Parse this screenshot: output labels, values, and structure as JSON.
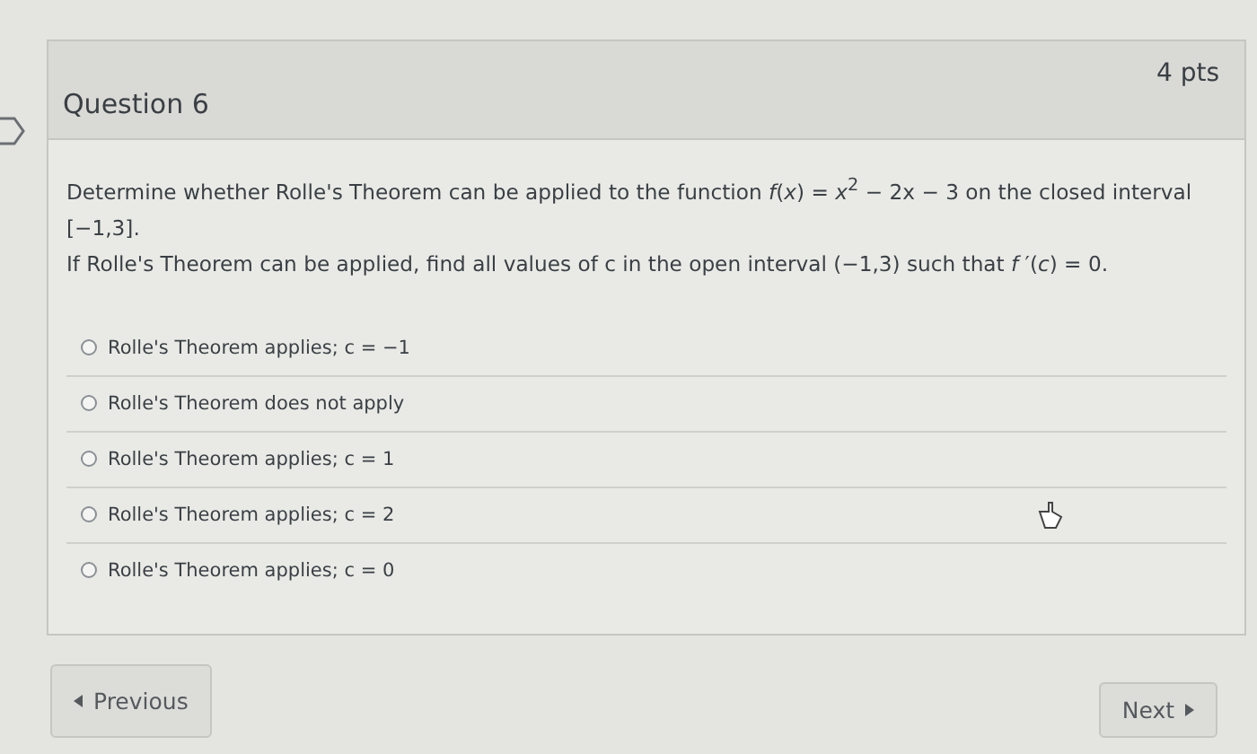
{
  "question": {
    "title": "Question 6",
    "points": "4 pts",
    "prompt": [
      "Determine whether Rolle's Theorem can be applied to the function *f*(*x*) = *x*$^{2}$ − 2x − 3 on the closed interval [−1,3].",
      "If Rolle's Theorem can be applied, find all values of c in the open interval (−1,3) such that *f* ′(*c*) = 0."
    ],
    "answers": [
      {
        "label": "Rolle's Theorem applies; c = −1",
        "selected": false
      },
      {
        "label": "Rolle's Theorem does not apply",
        "selected": false
      },
      {
        "label": "Rolle's Theorem applies; c = 1",
        "selected": false
      },
      {
        "label": "Rolle's Theorem applies; c = 2",
        "selected": false
      },
      {
        "label": "Rolle's Theorem applies; c = 0",
        "selected": false
      }
    ]
  },
  "navigation": {
    "previous": "Previous",
    "next": "Next"
  }
}
